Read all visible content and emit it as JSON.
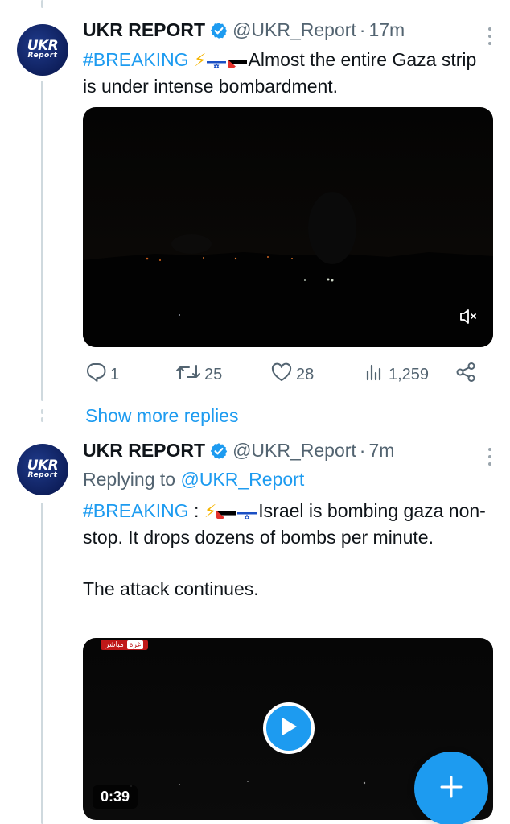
{
  "tweets": [
    {
      "author_name": "UKR REPORT",
      "handle": "@UKR_Report",
      "separator": "·",
      "time": "17m",
      "avatar_top": "UKR",
      "avatar_bottom": "Report",
      "text_hashtag": "#BREAKING",
      "text_body": "Almost the entire Gaza strip is under intense bombardment.",
      "media_type": "video-autoplay-muted",
      "stats": {
        "replies": "1",
        "retweets": "25",
        "likes": "28",
        "views": "1,259"
      }
    },
    {
      "author_name": "UKR REPORT",
      "handle": "@UKR_Report",
      "separator": "·",
      "time": "7m",
      "avatar_top": "UKR",
      "avatar_bottom": "Report",
      "replying_prefix": "Replying to",
      "replying_to": "@UKR_Report",
      "text_hashtag": "#BREAKING",
      "text_colon": " :",
      "text_body": "Israel is bombing gaza non-stop. It drops dozens of bombs per minute.",
      "text_body_2": "The attack continues.",
      "media_type": "video-paused",
      "duration": "0:39",
      "channel_tag": "غزة",
      "channel_tag_2": "مباشر"
    }
  ],
  "show_more_replies": "Show more replies",
  "icons": {
    "verified": "verified-badge-icon",
    "more": "more-vertical-icon",
    "reply": "reply-icon",
    "retweet": "retweet-icon",
    "like": "heart-icon",
    "views": "views-icon",
    "share": "share-icon",
    "mute": "mute-icon",
    "play": "play-icon",
    "compose": "plus-icon"
  },
  "colors": {
    "accent": "#1d9bf0",
    "text": "#0f1419",
    "muted": "#536471",
    "thread_line": "#cfd9de"
  }
}
